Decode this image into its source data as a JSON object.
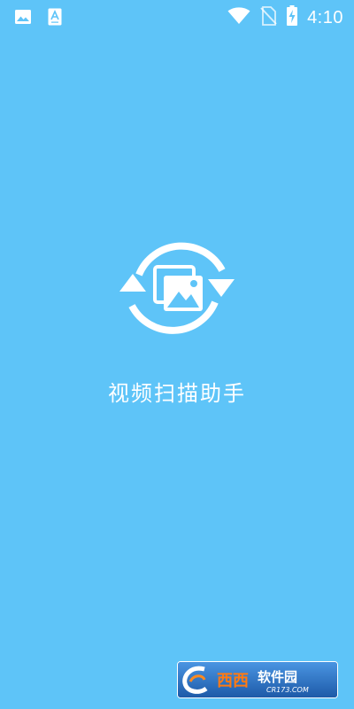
{
  "status_bar": {
    "time": "4:10",
    "icons": [
      "gallery-notification-icon",
      "text-notification-icon",
      "wifi-icon",
      "no-sim-icon",
      "battery-charging-icon"
    ]
  },
  "app": {
    "title": "视频扫描助手",
    "logo_icon": "photo-sync-icon"
  },
  "watermark": {
    "text": "西西软件园",
    "subtext": "CR173.COM"
  },
  "colors": {
    "background": "#5ec4f8",
    "foreground": "#ffffff",
    "watermark_bg": "#2f78c8"
  }
}
